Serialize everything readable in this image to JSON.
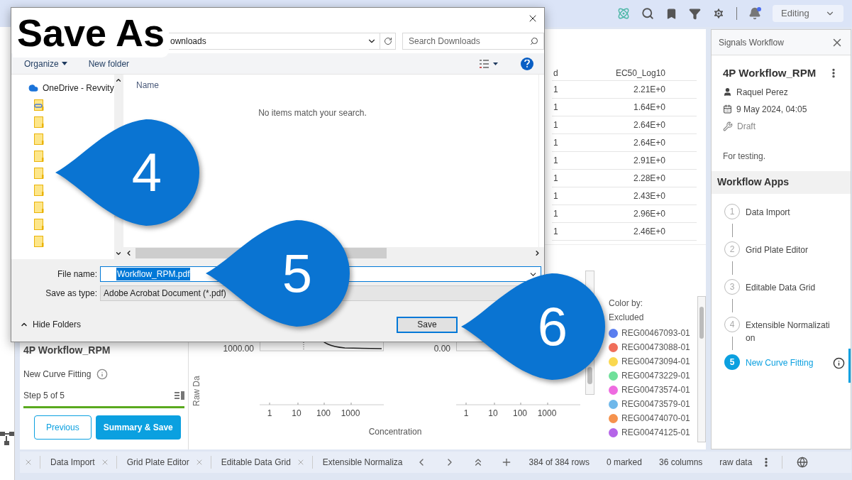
{
  "top_bar": {
    "mode": "Editing"
  },
  "dialog": {
    "heading": "Save As",
    "address": "ownloads",
    "search_placeholder": "Search Downloads",
    "toolbar": [
      "Organize",
      "New folder"
    ],
    "nav_items": [
      {
        "kind": "cloud",
        "label": "OneDrive - Revvity"
      },
      {
        "kind": "linked-folder"
      },
      {
        "kind": "folder"
      },
      {
        "kind": "folder"
      },
      {
        "kind": "folder"
      },
      {
        "kind": "folder"
      },
      {
        "kind": "folder"
      },
      {
        "kind": "folder"
      },
      {
        "kind": "folder"
      },
      {
        "kind": "folder"
      }
    ],
    "list_header": "Name",
    "empty_message": "No items match your search.",
    "file_name_label": "File name:",
    "file_name": "Workflow_RPM.pdf",
    "type_label": "Save as type:",
    "type_value": "Adobe Acrobat Document (*.pdf)",
    "hide_folders": "Hide Folders",
    "save_button": "Save"
  },
  "table": {
    "columns": [
      "d",
      "EC50_Log10"
    ],
    "rows": [
      [
        "1",
        "2.21E+0"
      ],
      [
        "1",
        "1.64E+0"
      ],
      [
        "1",
        "2.64E+0"
      ],
      [
        "1",
        "2.64E+0"
      ],
      [
        "1",
        "2.91E+0"
      ],
      [
        "1",
        "2.28E+0"
      ],
      [
        "1",
        "2.43E+0"
      ],
      [
        "1",
        "2.96E+0"
      ],
      [
        "1",
        "2.46E+0"
      ]
    ]
  },
  "summary_card": {
    "title": "4P Workflow_RPM",
    "app": "New Curve Fitting",
    "step": "Step 5 of 5",
    "progress": {
      "level": 1
    },
    "buttons": [
      {
        "label": "Previous",
        "kind": "outline"
      },
      {
        "label": "Summary & Save",
        "kind": "primary"
      }
    ]
  },
  "plots": [
    {
      "y_label": "Raw Da",
      "y_tick": "1000.00",
      "x_ticks": [
        "1",
        "10",
        "100",
        "1000"
      ]
    },
    {
      "y_tick": "0.00",
      "x_ticks": [
        "1",
        "10",
        "100",
        "1000"
      ]
    }
  ],
  "x_label": "Concentration",
  "legend": {
    "title": "Color by:",
    "subtitle": "Excluded",
    "items": [
      {
        "label": "REG00467093-01",
        "color": "#5b7ff0"
      },
      {
        "label": "REG00473088-01",
        "color": "#f06e5a"
      },
      {
        "label": "REG00473094-01",
        "color": "#fad84f"
      },
      {
        "label": "REG00473229-01",
        "color": "#6fe09a"
      },
      {
        "label": "REG00473574-01",
        "color": "#ee6be0"
      },
      {
        "label": "REG00473579-01",
        "color": "#6fb8ea"
      },
      {
        "label": "REG00474070-01",
        "color": "#f5924d"
      },
      {
        "label": "REG00474125-01",
        "color": "#b565e8"
      }
    ]
  },
  "workflow_panel": {
    "header": "Signals Workflow",
    "title": "4P Workflow_RPM",
    "author": "Raquel Perez",
    "date": "9 May 2024, 04:05",
    "status": "Draft",
    "description": "For testing.",
    "apps_heading": "Workflow Apps",
    "steps": [
      {
        "number": "1",
        "label": "Data Import",
        "selected": false
      },
      {
        "number": "2",
        "label": "Grid Plate Editor",
        "selected": false
      },
      {
        "number": "3",
        "label": "Editable Data Grid",
        "selected": false
      },
      {
        "number": "4",
        "label": "Extensible Normalization",
        "selected": false
      },
      {
        "number": "5",
        "label": "New Curve Fitting",
        "selected": true
      }
    ]
  },
  "bottom_bar": {
    "tabs": [
      "Data Import",
      "Grid Plate Editor",
      "Editable Data Grid",
      "Extensible Normaliza"
    ],
    "stats": [
      "384 of 384 rows",
      "0 marked",
      "36 columns",
      "raw data"
    ]
  },
  "callouts": [
    {
      "number": "4"
    },
    {
      "number": "5"
    },
    {
      "number": "6"
    }
  ]
}
